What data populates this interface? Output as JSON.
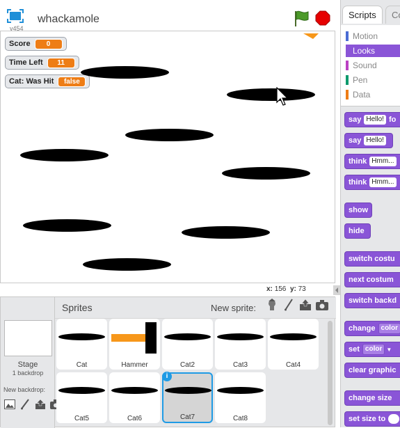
{
  "header": {
    "version": "v454",
    "project_title": "whackamole"
  },
  "monitors": [
    {
      "label": "Score",
      "value": "0"
    },
    {
      "label": "Time Left",
      "value": "11"
    },
    {
      "label": "Cat: Was Hit",
      "value": "false"
    }
  ],
  "stage_readout": {
    "x_label": "x:",
    "x_value": "156",
    "y_label": "y:",
    "y_value": "73"
  },
  "sprite_pane": {
    "title": "Sprites",
    "new_sprite_label": "New sprite:",
    "stage_label": "Stage",
    "backdrop_count": "1 backdrop",
    "new_backdrop_label": "New backdrop:",
    "sprites": [
      {
        "name": "Cat"
      },
      {
        "name": "Hammer"
      },
      {
        "name": "Cat2"
      },
      {
        "name": "Cat3"
      },
      {
        "name": "Cat4"
      },
      {
        "name": "Cat5"
      },
      {
        "name": "Cat6"
      },
      {
        "name": "Cat7",
        "selected": true
      },
      {
        "name": "Cat8"
      }
    ]
  },
  "palette": {
    "tabs": [
      "Scripts",
      "Co"
    ],
    "categories": [
      {
        "label": "Motion",
        "color": "#4a6cd4"
      },
      {
        "label": "Looks",
        "color": "#8a55d7",
        "active": true
      },
      {
        "label": "Sound",
        "color": "#bb42c3"
      },
      {
        "label": "Pen",
        "color": "#0e9a6c"
      },
      {
        "label": "Data",
        "color": "#ee7d16"
      }
    ],
    "blocks": {
      "say_fo": {
        "text": "say",
        "arg": "Hello!",
        "tail": "fo"
      },
      "say": {
        "text": "say",
        "arg": "Hello!"
      },
      "think_fo": {
        "text": "think",
        "arg": "Hmm..."
      },
      "think": {
        "text": "think",
        "arg": "Hmm..."
      },
      "show": {
        "text": "show"
      },
      "hide": {
        "text": "hide"
      },
      "switch_costume": {
        "text": "switch costu"
      },
      "next_costume": {
        "text": "next costum"
      },
      "switch_backdrop": {
        "text": "switch backd"
      },
      "change_effect": {
        "text": "change",
        "arg": "color"
      },
      "set_effect": {
        "text": "set",
        "arg": "color"
      },
      "clear_graphic": {
        "text": "clear graphic"
      },
      "change_size": {
        "text": "change size"
      },
      "set_size": {
        "text": "set size to"
      }
    }
  },
  "colors": {
    "looks": "#8a55d7",
    "monitor_value": "#ee7d16",
    "selection": "#1f9be5"
  }
}
